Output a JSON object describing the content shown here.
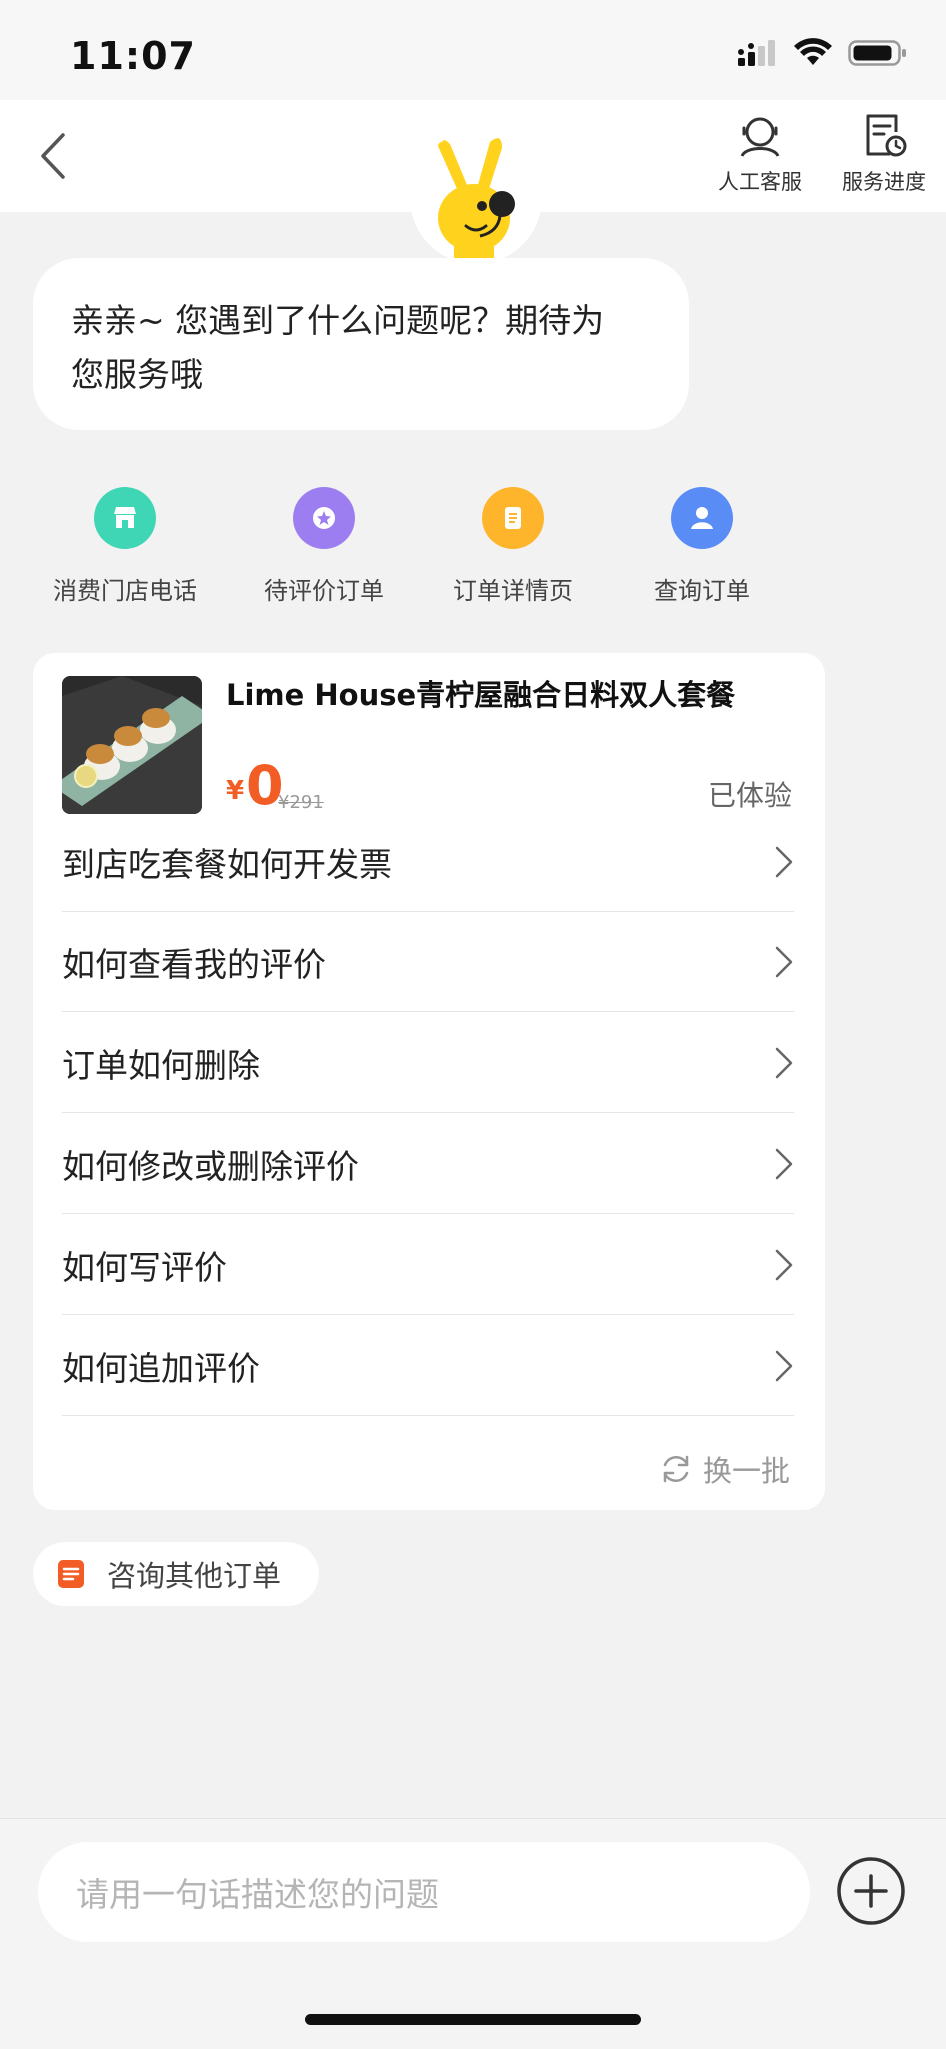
{
  "status_bar": {
    "time": "11:07"
  },
  "header": {
    "actions": [
      {
        "label": "人工客服",
        "icon": "headset-agent-icon"
      },
      {
        "label": "服务进度",
        "icon": "progress-clock-icon"
      }
    ]
  },
  "greeting": {
    "line1": "亲亲~ 您遇到了什么问题呢？期待为",
    "line2": "您服务哦"
  },
  "quick_actions": [
    {
      "label": "消费门店电话",
      "icon": "store-icon",
      "color": "#3ed6b4"
    },
    {
      "label": "待评价订单",
      "icon": "star-badge-icon",
      "color": "#9c7ef0"
    },
    {
      "label": "订单详情页",
      "icon": "document-icon",
      "color": "#ffb52b"
    },
    {
      "label": "查询订单",
      "icon": "user-icon",
      "color": "#5a8cf5"
    }
  ],
  "order": {
    "title": "Lime House青柠屋融合日料双人套餐",
    "price_symbol": "¥",
    "price": "0",
    "original_price": "¥291",
    "status": "已体验"
  },
  "faq": [
    "到店吃套餐如何开发票",
    "如何查看我的评价",
    "订单如何删除",
    "如何修改或删除评价",
    "如何写评价",
    "如何追加评价"
  ],
  "refresh_label": "换一批",
  "other_orders_label": "咨询其他订单",
  "input": {
    "placeholder": "请用一句话描述您的问题"
  },
  "accent_color": "#f25c25"
}
